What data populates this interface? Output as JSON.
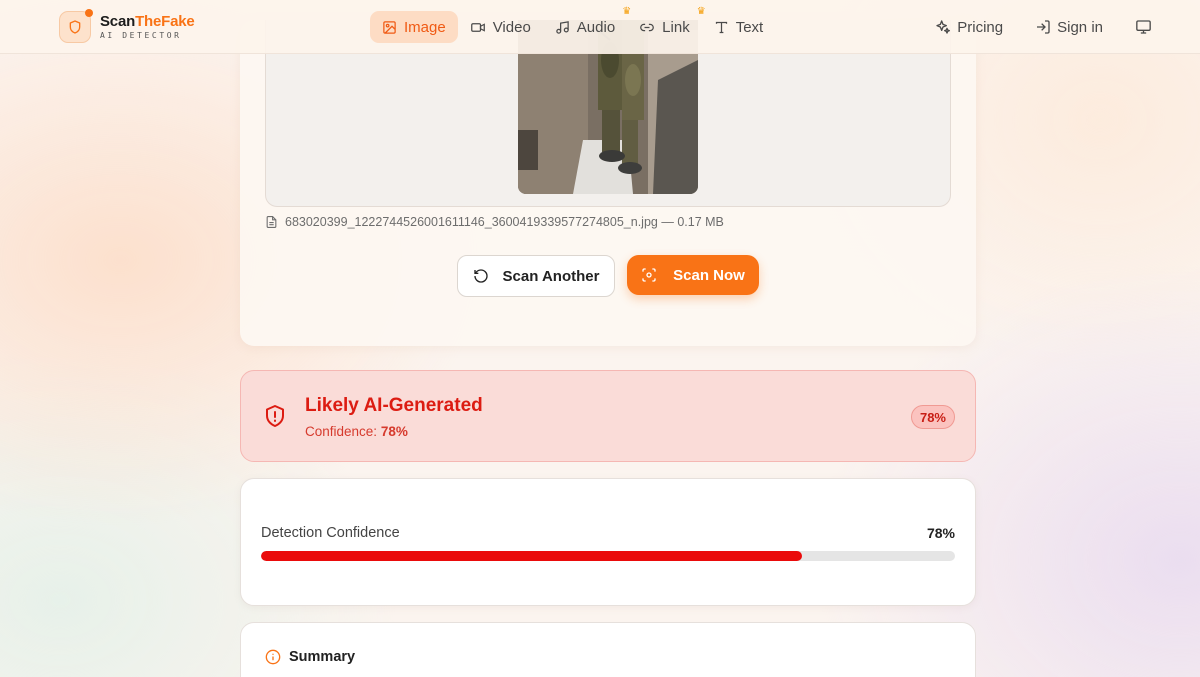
{
  "brand": {
    "name_part1": "Scan",
    "name_part2": "TheFake",
    "tagline": "AI DETECTOR",
    "accent_color": "#f97316"
  },
  "nav": {
    "items": [
      {
        "label": "Image",
        "icon": "image-icon",
        "active": true
      },
      {
        "label": "Video",
        "icon": "video-icon"
      },
      {
        "label": "Audio",
        "icon": "music-icon",
        "premium": true
      },
      {
        "label": "Link",
        "icon": "link-icon",
        "premium": true
      },
      {
        "label": "Text",
        "icon": "text-icon"
      }
    ],
    "pricing_label": "Pricing",
    "signin_label": "Sign in",
    "theme_icon": "monitor-icon"
  },
  "upload": {
    "file_name": "683020399_1222744526001611146_3600419339577274805_n.jpg",
    "separator": "—",
    "file_size": "0.17 MB",
    "scan_another_label": "Scan Another",
    "scan_now_label": "Scan Now"
  },
  "result": {
    "title": "Likely AI-Generated",
    "confidence_prefix": "Confidence:",
    "confidence_value": "78%",
    "badge": "78%",
    "status_color": "#dc1c12"
  },
  "detection": {
    "label": "Detection Confidence",
    "value": "78%",
    "fraction": 0.78,
    "bar_color": "#ea0b0b"
  },
  "summary": {
    "title": "Summary"
  }
}
